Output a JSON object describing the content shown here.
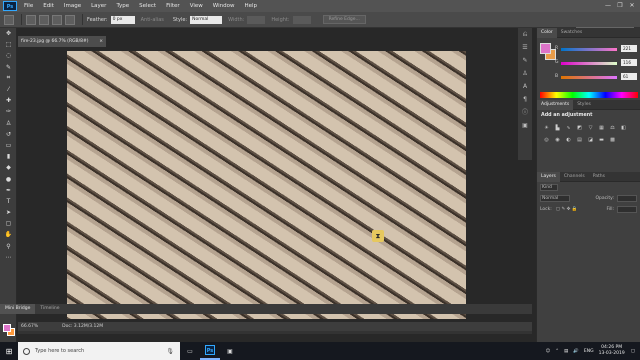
{
  "menubar": {
    "logo": "Ps",
    "items": [
      "File",
      "Edit",
      "Image",
      "Layer",
      "Type",
      "Select",
      "Filter",
      "View",
      "Window",
      "Help"
    ],
    "window_controls": [
      "—",
      "❐",
      "✕"
    ]
  },
  "options": {
    "feather_label": "Feather:",
    "feather_value": "0 px",
    "antialias_label": "Anti-alias",
    "style_label": "Style:",
    "style_value": "Normal",
    "width_label": "Width:",
    "height_label": "Height:",
    "refine_edge_label": "Refine Edge...",
    "workspace_value": "Essentials"
  },
  "document": {
    "tab_title": "fire-23.jpg @ 66.7% (RGB/8#)",
    "close_symbol": "×",
    "zoom": "66.67%",
    "doc_info": "Doc: 3.12M/3.12M"
  },
  "bottom_tabs": [
    "Mini Bridge",
    "Timeline"
  ],
  "panels": {
    "color_tabs": [
      "Color",
      "Swatches"
    ],
    "sliders": [
      {
        "label": "R",
        "value": "221"
      },
      {
        "label": "G",
        "value": "116"
      },
      {
        "label": "B",
        "value": "61"
      }
    ],
    "adjust_tabs": [
      "Adjustments",
      "Styles"
    ],
    "adjust_title": "Add an adjustment",
    "layers_tabs": [
      "Layers",
      "Channels",
      "Paths"
    ],
    "kind_label": "Kind",
    "normal_label": "Normal",
    "opacity_label": "Opacity:",
    "lock_label": "Lock:",
    "fill_label": "Fill:"
  },
  "colors": {
    "foreground": "#dd74c9",
    "background": "#ff9a3d",
    "ps_blue": "#31a8ff"
  },
  "taskbar": {
    "search_placeholder": "Type here to search",
    "language": "ENG",
    "time": "04:26 PM",
    "date": "13-03-2019"
  }
}
